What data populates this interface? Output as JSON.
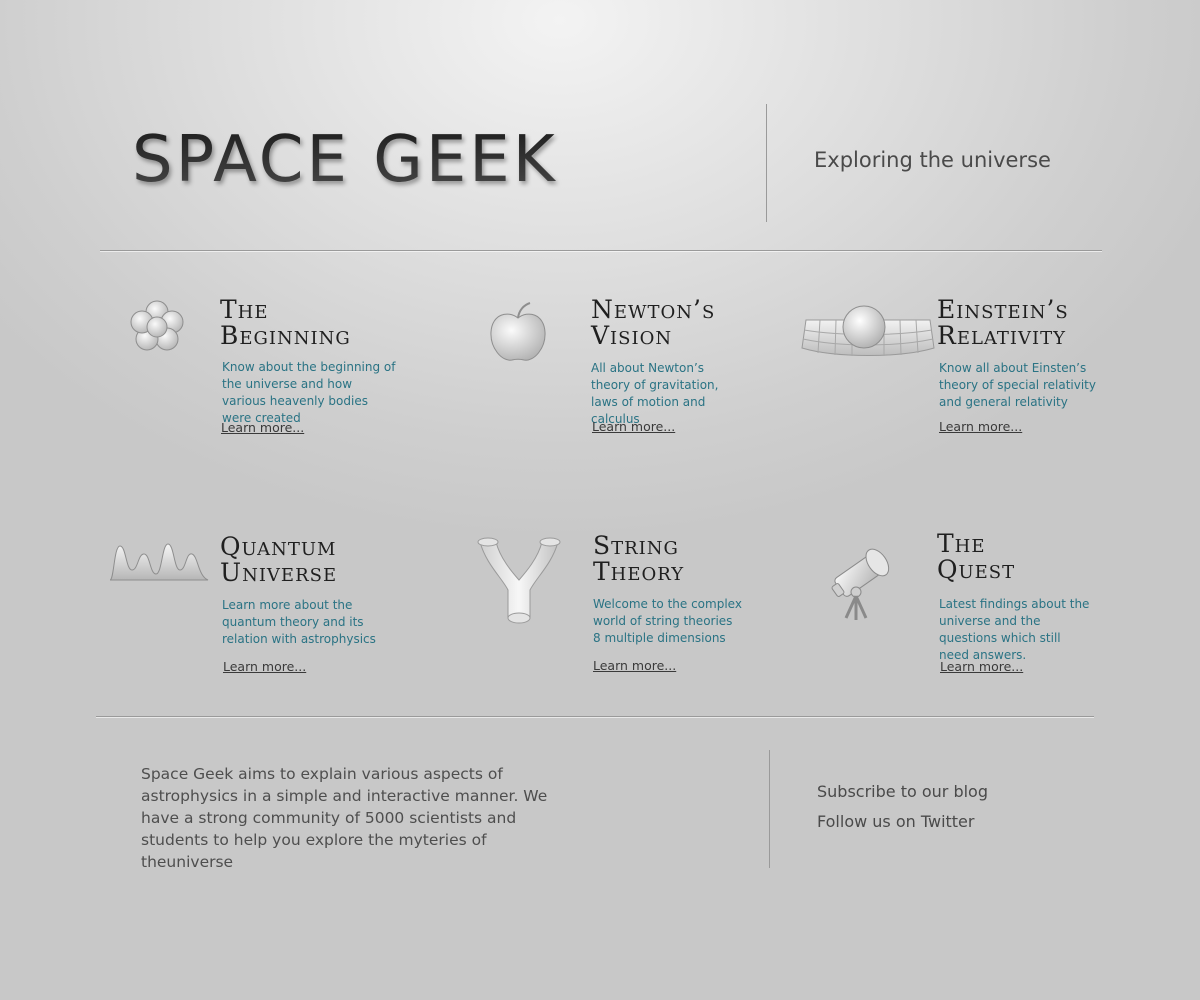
{
  "header": {
    "logo": "SPACE GEEK",
    "tagline": "Exploring the universe"
  },
  "features": [
    {
      "title_line1": "The",
      "title_line2": "Beginning",
      "description": "Know about the beginning of the universe and how various heavenly bodies were created",
      "link": "Learn more...",
      "icon": "flower-icon"
    },
    {
      "title_line1": "Newton’s",
      "title_line2": "Vision",
      "description": "All about Newton’s theory of gravitation, laws of motion and calculus",
      "link": "Learn more...",
      "icon": "apple-icon"
    },
    {
      "title_line1": "Einstein’s",
      "title_line2": "Relativity",
      "description": "Know all about Einsten’s theory of special relativity and general relativity",
      "link": "Learn more...",
      "icon": "spacetime-grid-icon"
    },
    {
      "title_line1": "Quantum",
      "title_line2": "Universe",
      "description": "Learn more about the quantum theory and its relation with astrophysics",
      "link": "Learn more...",
      "icon": "wave-icon"
    },
    {
      "title_line1": "String",
      "title_line2": "Theory",
      "description": "Welcome to the complex world of string theories 8 multiple dimensions",
      "link": "Learn more...",
      "icon": "y-tube-icon"
    },
    {
      "title_line1": "The",
      "title_line2": "Quest",
      "description": "Latest findings about the universe and the questions which still need answers.",
      "link": "Learn more...",
      "icon": "telescope-icon"
    }
  ],
  "footer": {
    "about": "Space Geek aims to explain various aspects of astrophysics in a simple and interactive manner. We have a strong community of 5000 scientists and students to help you explore the myteries of theuniverse",
    "subscribe": "Subscribe to our blog",
    "follow": "Follow us on Twitter"
  },
  "colors": {
    "accent_text": "#2a7384",
    "heading": "#1f1f1f",
    "divider": "#9a9a9a"
  }
}
